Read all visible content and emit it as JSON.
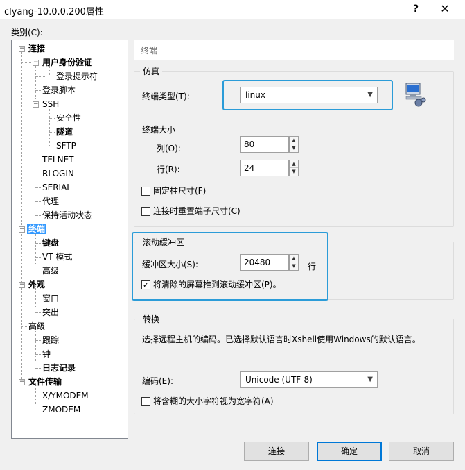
{
  "window": {
    "title": "clyang-10.0.0.200属性",
    "help_btn": "?",
    "close_btn": "✕"
  },
  "category_label": "类别(C):",
  "tree": [
    {
      "label": "连接",
      "bold": true
    },
    {
      "label": "用户身份验证",
      "bold": true
    },
    {
      "label": "登录提示符"
    },
    {
      "label": "登录脚本"
    },
    {
      "label": "SSH"
    },
    {
      "label": "安全性"
    },
    {
      "label": "隧道",
      "bold": true
    },
    {
      "label": "SFTP"
    },
    {
      "label": "TELNET"
    },
    {
      "label": "RLOGIN"
    },
    {
      "label": "SERIAL"
    },
    {
      "label": "代理"
    },
    {
      "label": "保持活动状态"
    },
    {
      "label": "终端",
      "bold": true,
      "selected": true
    },
    {
      "label": "键盘",
      "bold": true
    },
    {
      "label": "VT 模式"
    },
    {
      "label": "高级"
    },
    {
      "label": "外观",
      "bold": true
    },
    {
      "label": "窗口"
    },
    {
      "label": "突出"
    },
    {
      "label": "高级"
    },
    {
      "label": "跟踪"
    },
    {
      "label": "钟"
    },
    {
      "label": "日志记录",
      "bold": true
    },
    {
      "label": "文件传输",
      "bold": true
    },
    {
      "label": "X/YMODEM"
    },
    {
      "label": "ZMODEM"
    }
  ],
  "panel": {
    "title": "终端",
    "emulation": {
      "legend": "仿真",
      "type_label": "终端类型(T):",
      "type_value": "linux",
      "size_label": "终端大小",
      "cols_label": "列(O):",
      "cols_value": "80",
      "rows_label": "行(R):",
      "rows_value": "24",
      "fixed_size": "固定柱尺寸(F)",
      "reset_on_connect": "连接时重置端子尺寸(C)"
    },
    "scroll": {
      "legend": "滚动缓冲区",
      "size_label": "缓冲区大小(S):",
      "size_value": "20480",
      "unit": "行",
      "push_cleared": "将清除的屏幕推到滚动缓冲区(P)。"
    },
    "translate": {
      "legend": "转换",
      "desc": "选择远程主机的编码。已选择默认语言时Xshell使用Windows的默认语言。",
      "enc_label": "编码(E):",
      "enc_value": "Unicode (UTF-8)",
      "ambiguous": "将含糊的大小字符视为宽字符(A)"
    }
  },
  "buttons": {
    "connect": "连接",
    "ok": "确定",
    "cancel": "取消"
  },
  "colors": {
    "highlight": "#2b9cd8",
    "selection": "#3399ff",
    "default_button_border": "#0078d7"
  }
}
